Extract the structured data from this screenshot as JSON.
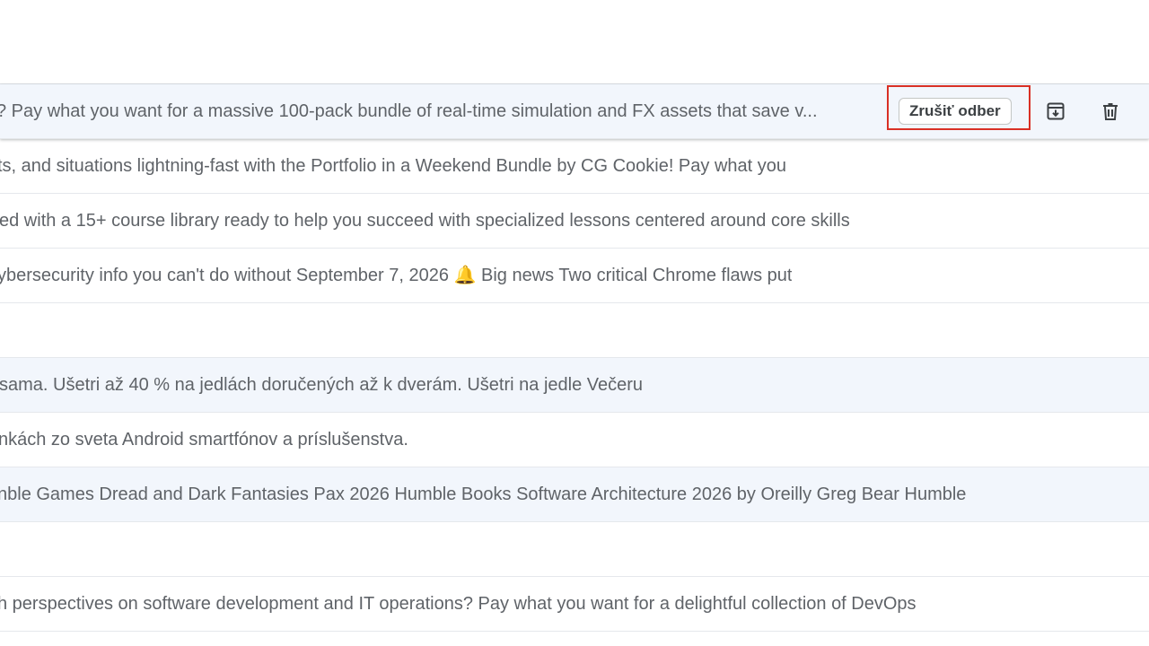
{
  "mail_list": {
    "rows": [
      {
        "snippet": "? Pay what you want for a massive 100-pack bundle of real-time simulation and FX assets that save v...",
        "state": "hovered"
      },
      {
        "snippet": "ts, and situations lightning-fast with the Portfolio in a Weekend Bundle by CG Cookie! Pay what you",
        "state": "unread"
      },
      {
        "snippet": "ed with a 15+ course library ready to help you succeed with specialized lessons centered around core skills",
        "state": "unread"
      },
      {
        "snippet": "ybersecurity info you can't do without September 7, 2026 🔔 Big news Two critical Chrome flaws put",
        "state": "unread"
      },
      {
        "snippet": "",
        "state": "unread"
      },
      {
        "snippet": "sama. Ušetri až 40 % na jedlách doručených až k dverám. Ušetri na jedle Večeru",
        "state": "read"
      },
      {
        "snippet": "nkách zo sveta Android smartfónov a príslušenstva.",
        "state": "unread"
      },
      {
        "snippet": "nble Games Dread and Dark Fantasies Pax 2026 Humble Books Software Architecture 2026 by Oreilly Greg Bear Humble",
        "state": "read"
      },
      {
        "snippet": "",
        "state": "unread"
      },
      {
        "snippet": "h perspectives on software development and IT operations? Pay what you want for a delightful collection of DevOps",
        "state": "unread"
      }
    ]
  },
  "hover_actions": {
    "unsubscribe_label": "Zrušiť odber",
    "archive_icon": "archive-icon",
    "delete_icon": "trash-icon"
  },
  "colors": {
    "read_row_bg": "#f2f6fc",
    "unread_row_bg": "#ffffff",
    "highlight_border": "#d93025",
    "snippet_text": "#5f6368"
  }
}
